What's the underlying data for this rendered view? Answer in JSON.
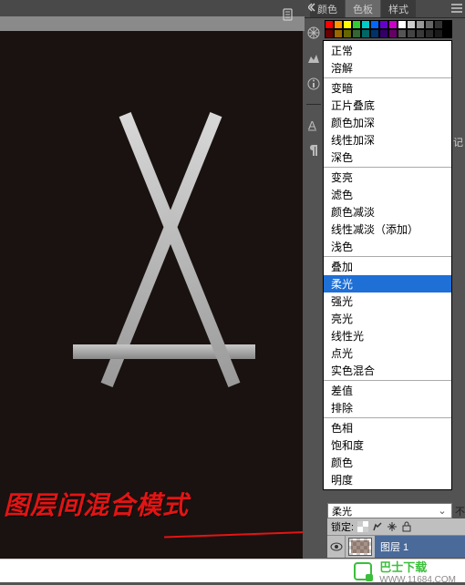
{
  "panel_tabs": {
    "color": "颜色",
    "swatches": "色板",
    "styles": "样式"
  },
  "right_label": "记",
  "blend_modes": {
    "groups": [
      [
        "正常",
        "溶解"
      ],
      [
        "变暗",
        "正片叠底",
        "颜色加深",
        "线性加深",
        "深色"
      ],
      [
        "变亮",
        "滤色",
        "颜色减淡",
        "线性减淡（添加）",
        "浅色"
      ],
      [
        "叠加",
        "柔光",
        "强光",
        "亮光",
        "线性光",
        "点光",
        "实色混合"
      ],
      [
        "差值",
        "排除"
      ],
      [
        "色相",
        "饱和度",
        "颜色",
        "明度"
      ]
    ],
    "selected": "柔光"
  },
  "blend_select": {
    "value": "柔光"
  },
  "opacity_label": "不",
  "lock_row": {
    "label": "锁定:"
  },
  "layer": {
    "name": "图层 1"
  },
  "annotation": "图层间混合模式",
  "swatch_colors_top": [
    "#ff0000",
    "#ff9900",
    "#ffff00",
    "#33cc33",
    "#00cccc",
    "#0066ff",
    "#6600cc",
    "#cc00cc",
    "#ffffff",
    "#cccccc",
    "#999999",
    "#666666",
    "#333333",
    "#000000"
  ],
  "swatch_colors_bot": [
    "#660000",
    "#996600",
    "#666600",
    "#336633",
    "#006666",
    "#003366",
    "#330066",
    "#660066",
    "#555555",
    "#444444",
    "#3a3a3a",
    "#2a2a2a",
    "#1a1a1a",
    "#000000"
  ],
  "footer": {
    "brand": "巴士下载",
    "url": "WWW.11684.COM"
  }
}
